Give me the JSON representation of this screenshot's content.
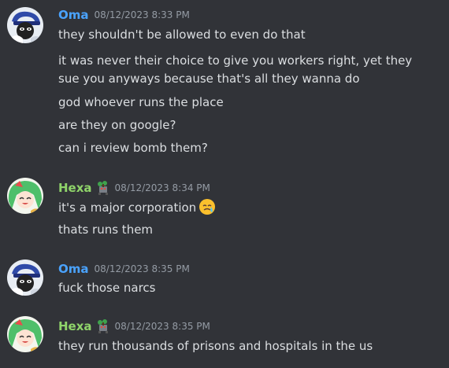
{
  "colors": {
    "background": "#313338",
    "oma_name": "#4aa3ff",
    "hexa_name": "#8fd46a",
    "timestamp": "#949ba4",
    "message_text": "#dbdee1"
  },
  "messages": [
    {
      "author": "Oma",
      "timestamp": "08/12/2023 8:33 PM",
      "lines": [
        "they shouldn't be allowed to even do that",
        "it was never their choice to give you workers right, yet they sue you anyways because that's all they wanna do",
        "god whoever runs the place",
        "are they on google?",
        "can i review bomb them?"
      ]
    },
    {
      "author": "Hexa",
      "badge_icon": "clover-robot-badge-icon",
      "timestamp": "08/12/2023 8:34 PM",
      "lines": [
        "it's a major corporation",
        "thats runs them"
      ],
      "emoji": "crying-sweat-emoji-icon"
    },
    {
      "author": "Oma",
      "timestamp": "08/12/2023 8:35 PM",
      "lines": [
        "fuck those narcs"
      ]
    },
    {
      "author": "Hexa",
      "badge_icon": "clover-robot-badge-icon",
      "timestamp": "08/12/2023 8:35 PM",
      "lines": [
        "they run thousands of prisons and hospitals in the us"
      ]
    }
  ]
}
